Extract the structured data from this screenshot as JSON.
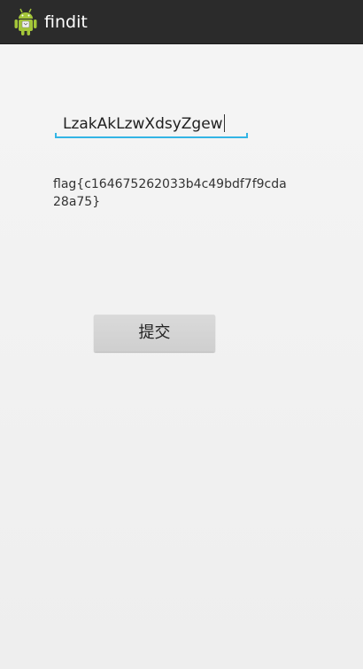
{
  "action_bar": {
    "title": "findit",
    "icon": "android-robot-icon",
    "background": "#2b2b2b"
  },
  "input": {
    "value": "LzakAkLzwXdsyZgew",
    "underline_color": "#33b5e5"
  },
  "result": {
    "text": "flag{c164675262033b4c49bdf7f9cda28a75}"
  },
  "submit_button": {
    "label": "提交"
  }
}
